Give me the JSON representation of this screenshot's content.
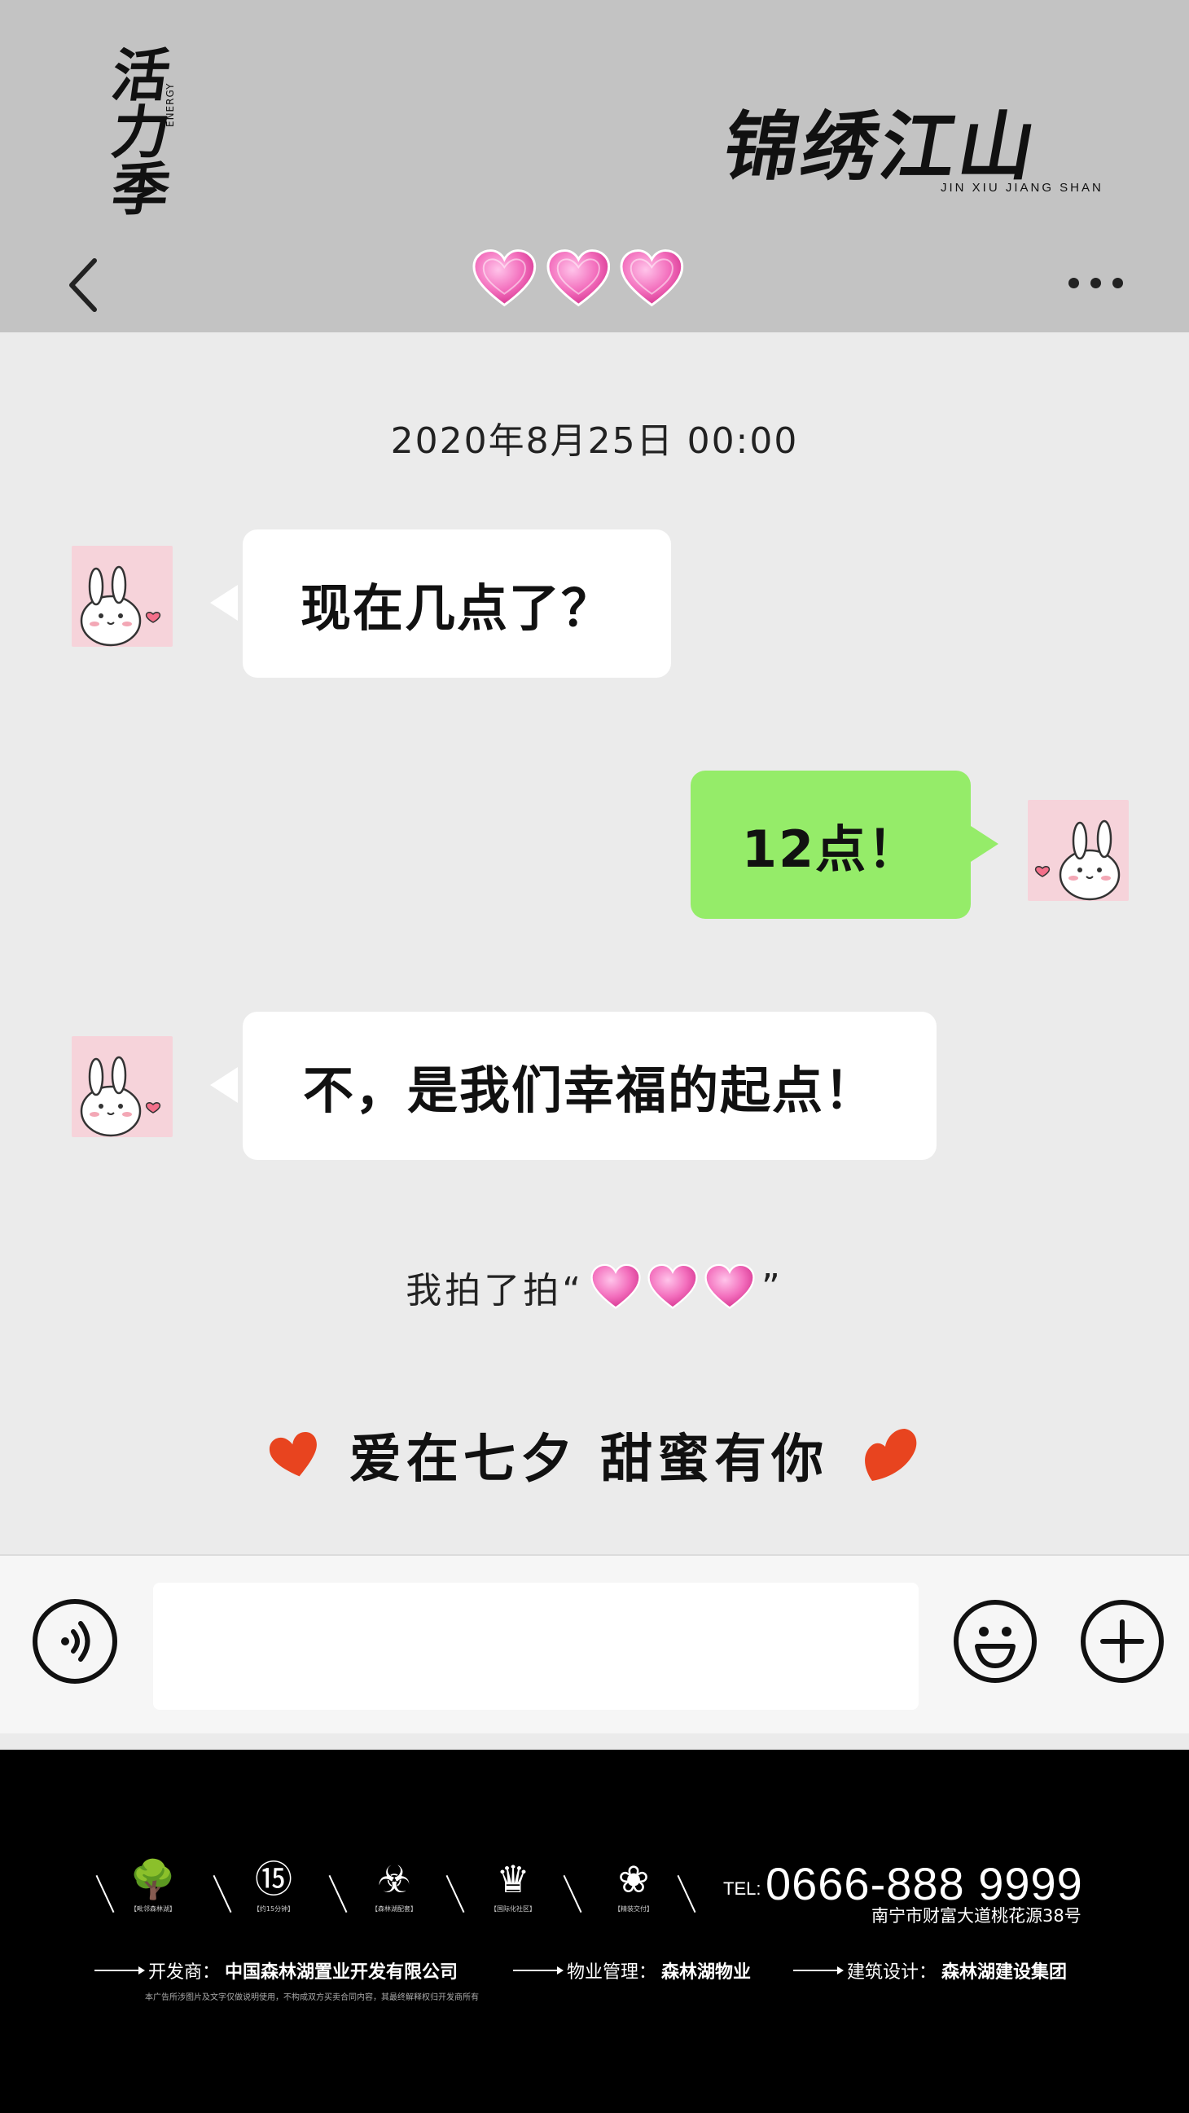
{
  "header": {
    "brand_left_chars": [
      "活",
      "力",
      "季"
    ],
    "brand_left_energy": "ENERGY",
    "brand_right_title": "锦绣江山",
    "brand_right_pinyin": "JIN XIU JIANG SHAN",
    "back_icon": "chevron-left-icon",
    "title_icons": [
      "heart-icon",
      "heart-icon",
      "heart-icon"
    ],
    "more_icon": "ellipsis-icon"
  },
  "chat": {
    "timestamp": "2020年8月25日 00:00",
    "messages": [
      {
        "side": "left",
        "text": "现在几点了？"
      },
      {
        "side": "right",
        "text": "12点！"
      },
      {
        "side": "left",
        "text": "不，是我们幸福的起点！"
      }
    ],
    "pat_prefix": "我拍了拍“",
    "pat_suffix": "”",
    "slogan": "爱在七夕 甜蜜有你"
  },
  "input_bar": {
    "voice_icon": "voice-icon",
    "message_value": "",
    "emoji_icon": "smiley-icon",
    "add_icon": "plus-icon"
  },
  "footer": {
    "icons": [
      {
        "glyph": "🌳",
        "caption": "【毗邻森林湖】"
      },
      {
        "glyph": "⑮",
        "caption": "【约15分钟】"
      },
      {
        "glyph": "☣",
        "caption": "【森林湖配套】"
      },
      {
        "glyph": "♛",
        "caption": "【国际化社区】"
      },
      {
        "glyph": "❀",
        "caption": "【精装交付】"
      }
    ],
    "tel_label": "TEL:",
    "tel_number": "0666-888 9999",
    "address": "南宁市财富大道桃花源38号",
    "credits": [
      {
        "label": "开发商：",
        "value": "中国森林湖置业开发有限公司"
      },
      {
        "label": "物业管理：",
        "value": "森林湖物业"
      },
      {
        "label": "建筑设计：",
        "value": "森林湖建设集团"
      }
    ],
    "disclaimer": "本广告所涉图片及文字仅做说明使用，不构成双方买卖合同内容，其最终解释权归开发商所有"
  },
  "colors": {
    "header_bg": "#c3c3c3",
    "chat_bg": "#ebebeb",
    "bubble_green": "#95ec69",
    "bubble_white": "#ffffff",
    "heart_pink": "#f06ab4",
    "heart_red": "#e8441f",
    "footer_bg": "#000000"
  }
}
